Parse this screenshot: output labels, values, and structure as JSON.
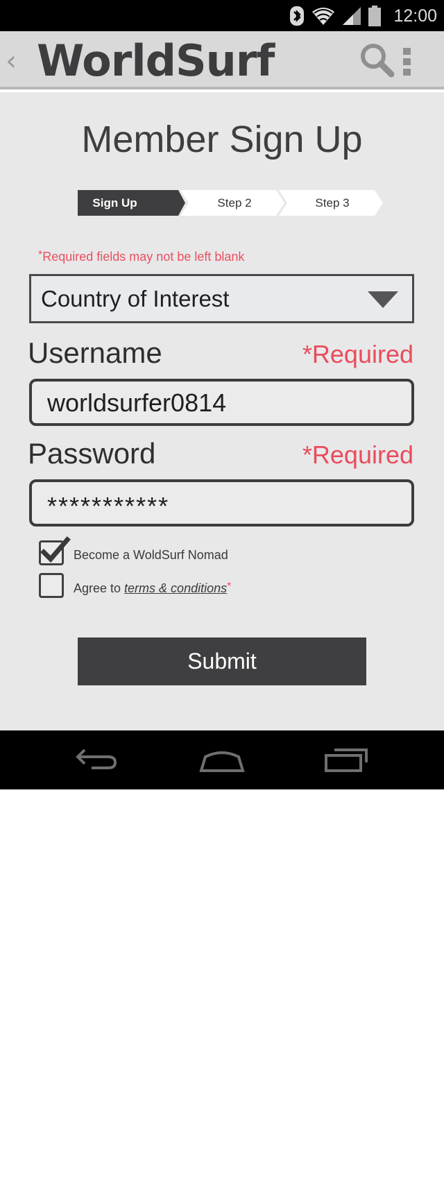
{
  "status_bar": {
    "time": "12:00",
    "icons": [
      "bluetooth-icon",
      "wifi-icon",
      "signal-icon",
      "battery-icon"
    ]
  },
  "action_bar": {
    "back": "‹",
    "title": "WorldSurf",
    "icons": [
      "search-icon",
      "overflow-menu-icon"
    ]
  },
  "page": {
    "title": "Member Sign Up"
  },
  "steps": [
    {
      "label": "Sign Up",
      "active": true
    },
    {
      "label": "Step 2",
      "active": false
    },
    {
      "label": "Step 3",
      "active": false
    }
  ],
  "form": {
    "required_note_asterisk": "*",
    "required_note": "Required fields may not be left blank",
    "country": {
      "value": "Country of Interest"
    },
    "username": {
      "label": "Username",
      "required": "*Required",
      "value": "worldsurfer0814"
    },
    "password": {
      "label": "Password",
      "required": "*Required",
      "value": "***********"
    },
    "nomad_checkbox": {
      "label": "Become a WoldSurf Nomad",
      "checked": true
    },
    "terms_checkbox": {
      "label_prefix": "Agree to ",
      "link": "terms & conditions",
      "asterisk": "*",
      "checked": false
    },
    "submit_label": "Submit"
  },
  "colors": {
    "accent_red": "#ea4c5b",
    "dark": "#3f3f41",
    "background": "#e8e8e9"
  },
  "nav_bar": {
    "icons": [
      "back-nav-icon",
      "home-nav-icon",
      "recent-apps-icon"
    ]
  }
}
